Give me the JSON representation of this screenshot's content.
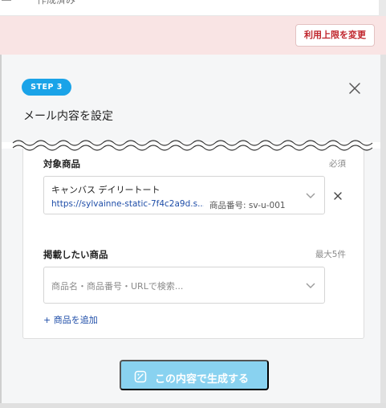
{
  "top": {
    "cut_text": "作成済み"
  },
  "notice": {
    "limit_button": "利用上限を変更"
  },
  "modal": {
    "step_badge": "STEP 3",
    "title": "メール内容を設定"
  },
  "target_product": {
    "label": "対象商品",
    "required_note": "必須",
    "name": "キャンバス デイリートート",
    "url": "https://sylvainne-static-7f4c2a9d.s...",
    "sku": "商品番号: sv-u-001"
  },
  "featured_products": {
    "label": "掲載したい商品",
    "max_note": "最大5件",
    "placeholder": "商品名・商品番号・URLで検索...",
    "add_link": "+ 商品を追加"
  },
  "generate_button": {
    "label": "この内容で生成する"
  },
  "colors": {
    "accent_blue": "#1aa3e8",
    "button_disabled": "#89d2f0",
    "link": "#1e4da8",
    "warning_text": "#c0262d",
    "notice_bg": "#f9e4e4"
  },
  "icons": [
    "close-icon",
    "chevron-down-icon",
    "remove-icon",
    "sparkle-edit-icon"
  ]
}
